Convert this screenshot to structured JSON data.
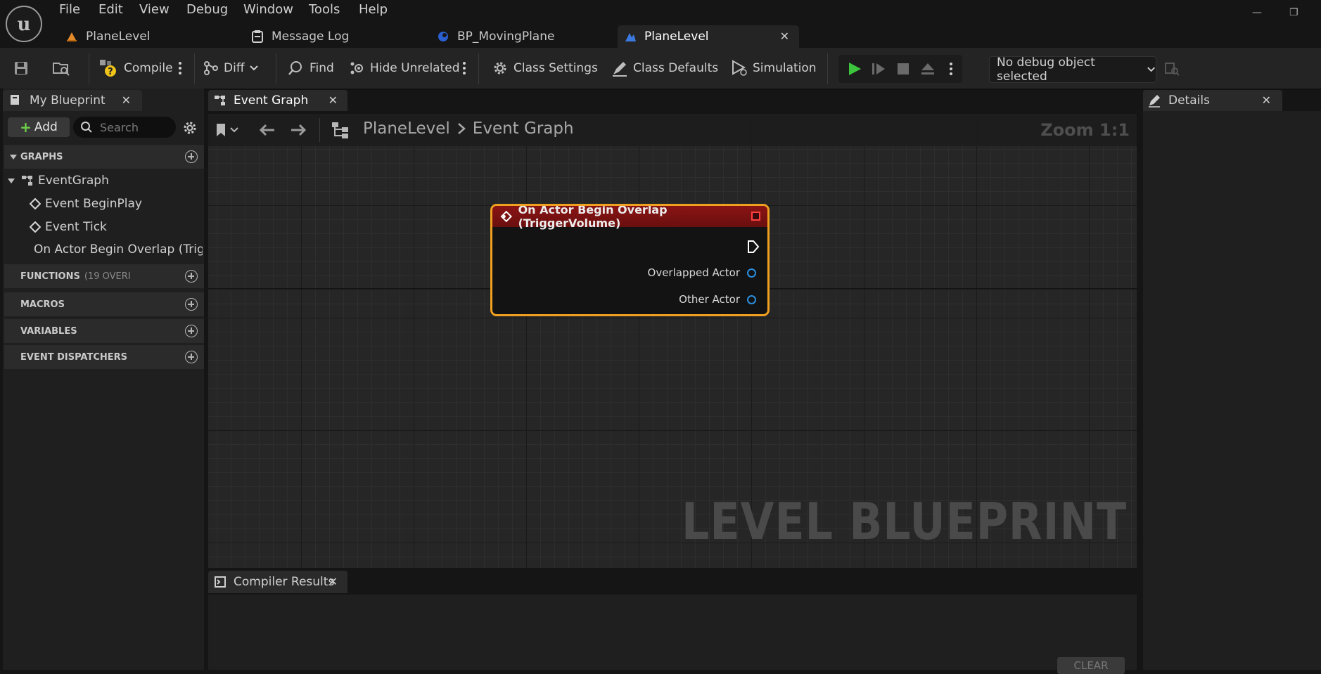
{
  "menu": [
    "File",
    "Edit",
    "View",
    "Debug",
    "Window",
    "Tools",
    "Help"
  ],
  "doc_tabs": [
    {
      "label": "PlaneLevel",
      "icon": "level-icon"
    },
    {
      "label": "Message Log",
      "icon": "message-log-icon"
    },
    {
      "label": "BP_MovingPlane",
      "icon": "blueprint-icon"
    },
    {
      "label": "PlaneLevel",
      "icon": "level-blueprint-icon",
      "active": true
    }
  ],
  "window_controls": {
    "minimize": "—",
    "restore": "❐"
  },
  "toolbar": {
    "compile": "Compile",
    "diff": "Diff",
    "find": "Find",
    "hide_unrelated": "Hide Unrelated",
    "class_settings": "Class Settings",
    "class_defaults": "Class Defaults",
    "simulation": "Simulation",
    "debug_object": "No debug object selected"
  },
  "my_blueprint": {
    "tab": "My Blueprint",
    "add": "Add",
    "search_placeholder": "Search",
    "sections": {
      "graphs": "GRAPHS",
      "functions": "FUNCTIONS",
      "functions_note": "(19 OVERI",
      "macros": "MACROS",
      "variables": "VARIABLES",
      "dispatchers": "EVENT DISPATCHERS"
    },
    "graph_root": "EventGraph",
    "events": [
      "Event BeginPlay",
      "Event Tick",
      "On Actor Begin Overlap (Trigg"
    ]
  },
  "graph_editor": {
    "tab": "Event Graph",
    "breadcrumb": [
      "PlaneLevel",
      "Event Graph"
    ],
    "zoom": "Zoom 1:1",
    "watermark": "LEVEL BLUEPRINT"
  },
  "node": {
    "title": "On Actor Begin Overlap (TriggerVolume)",
    "pins": [
      "Overlapped Actor",
      "Other Actor"
    ]
  },
  "compiler": {
    "tab": "Compiler Results",
    "clear": "CLEAR"
  },
  "details": {
    "tab": "Details"
  },
  "colors": {
    "accent": "#2a6fd6",
    "node_header": "#7a1111",
    "node_border": "#f0a020",
    "object_pin": "#2a8fe0",
    "play_green": "#3cc43c"
  }
}
